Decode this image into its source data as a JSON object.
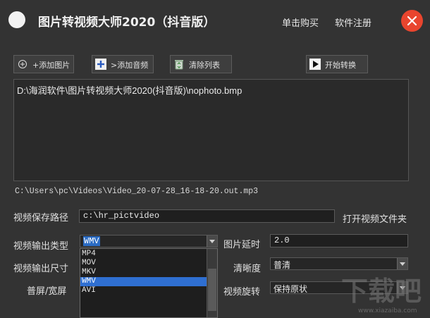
{
  "app": {
    "title": "图片转视频大师2020（抖音版）",
    "buy_link": "单击购买",
    "register_link": "软件注册"
  },
  "toolbar": {
    "add_image": "+添加图片",
    "add_audio": ">添加音频",
    "clear_list": "清除列表",
    "start_convert": "开始转换"
  },
  "file_list": {
    "items": [
      "D:\\海润软件\\图片转视频大师2020(抖音版)\\nophoto.bmp"
    ]
  },
  "audio_path": "C:\\Users\\pc\\Videos\\Video_20-07-28_16-18-20.out.mp3",
  "settings": {
    "save_path_label": "视频保存路径",
    "save_path_value": "c:\\hr_pictvideo",
    "open_folder_link": "打开视频文件夹",
    "output_type_label": "视频输出类型",
    "output_type_value": "WMV",
    "output_type_options": [
      "MP4",
      "MOV",
      "MKV",
      "WMV",
      "AVI"
    ],
    "output_type_selected_index": 3,
    "output_size_label": "视频输出尺寸",
    "screen_mode_label": "普屏/宽屏",
    "image_delay_label": "图片延时",
    "image_delay_value": "2.0",
    "clarity_label": "清晰度",
    "clarity_value": "普清",
    "rotation_label": "视频旋转",
    "rotation_value": "保持原状"
  },
  "watermark": {
    "text": "下载吧",
    "url": "www.xiazaiba.com"
  },
  "colors": {
    "background": "#333333",
    "close_button": "#e9452e",
    "selection": "#2f6fd1"
  },
  "icons": {
    "add_image": "plus-circle-icon",
    "add_audio": "plus-icon",
    "clear_list": "recycle-bin-icon",
    "start_convert": "play-icon",
    "close": "close-icon",
    "combo_arrow": "chevron-down-icon"
  }
}
